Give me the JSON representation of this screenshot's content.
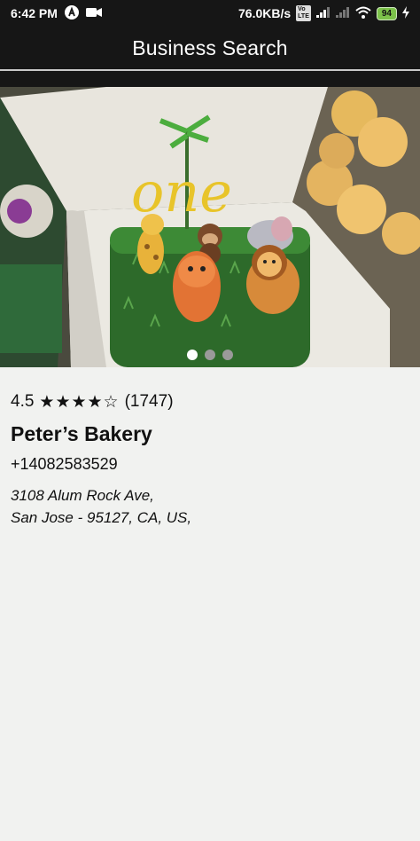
{
  "status_bar": {
    "time": "6:42 PM",
    "network_speed": "76.0KB/s",
    "battery": "94",
    "icons": [
      "a-icon",
      "video-camera-icon",
      "volte-icon",
      "signal-icon",
      "wifi-icon",
      "battery-icon",
      "charging-icon"
    ]
  },
  "app_bar": {
    "title": "Business Search"
  },
  "carousel": {
    "image_subject": "cake",
    "slide_count": 3,
    "active_index": 0
  },
  "business": {
    "rating": "4.5",
    "stars": "★★★★☆",
    "review_count": "(1747)",
    "name": "Peter’s Bakery",
    "phone": "+14082583529",
    "address_line1": "3108 Alum Rock Ave,",
    "address_line2": "San Jose - 95127, CA, US,"
  },
  "colors": {
    "app_bar": "#161616",
    "background": "#f1f2f0",
    "battery": "#7cc24a"
  }
}
